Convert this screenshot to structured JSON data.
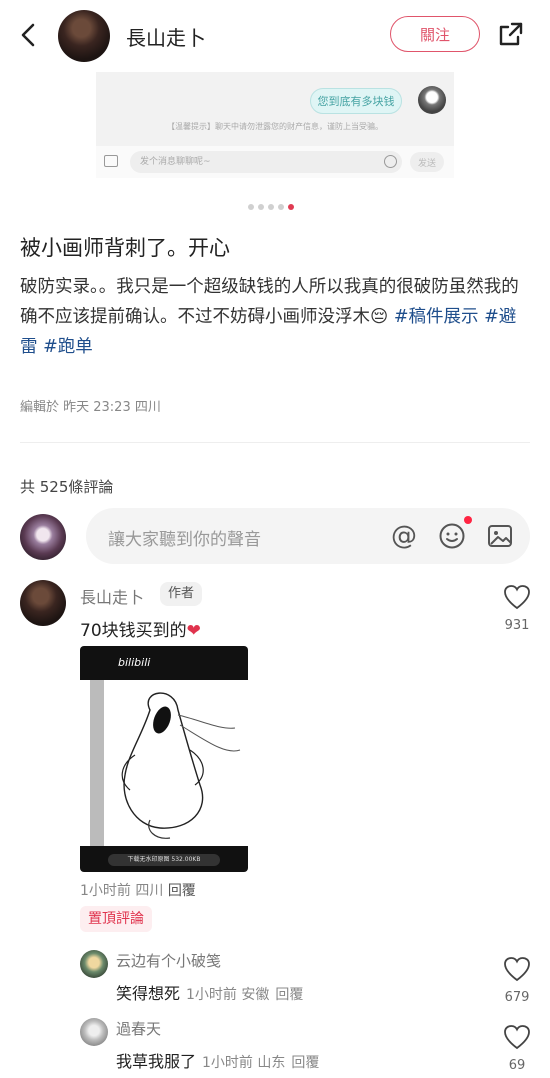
{
  "header": {
    "author_name": "長山走卜",
    "follow_label": "關注",
    "back_icon": "chevron-left-icon",
    "share_icon": "share-icon"
  },
  "embedded_screenshot": {
    "bubble_text": "您到底有多块钱",
    "system_tip": "【温馨提示】聊天中请勿泄露您的财产信息，谨防上当受骗。",
    "input_placeholder": "发个消息聊聊呢~",
    "send_label": "发送"
  },
  "carousel": {
    "count": 5,
    "active_index": 4,
    "accent": "#e03b52"
  },
  "post": {
    "title": "被小画师背刺了。开心",
    "body_text": "破防实录。。我只是一个超级缺钱的人所以我真的很破防虽然我的确不应该提前确认。不过不妨碍小画师没浮木😔",
    "tags": [
      "#稿件展示",
      "#避雷",
      "#跑单"
    ],
    "meta": "編輯於 昨天 23:23 四川"
  },
  "comments_section": {
    "count_label": "共 525條評論",
    "input_placeholder": "讓大家聽到你的聲音",
    "icons": [
      "at-icon",
      "emoji-icon",
      "image-icon"
    ]
  },
  "comment": {
    "name": "長山走卜",
    "author_badge": "作者",
    "text": "70块钱买到的",
    "image_logo": "bilibili",
    "image_bar": "下载无水印原图 532.00KB",
    "meta": "1小时前 四川",
    "reply_label": "回覆",
    "pinned_label": "置頂評論",
    "likes": "931"
  },
  "replies": [
    {
      "name": "云边有个小破笺",
      "text": "笑得想死",
      "meta": "1小时前 安徽",
      "reply_label": "回覆",
      "likes": "679"
    },
    {
      "name": "過春天",
      "text": "我草我服了",
      "meta": "1小时前 山东",
      "reply_label": "回覆",
      "likes": "69"
    }
  ],
  "colors": {
    "brand": "#e0556b",
    "tag": "#1f4e8c",
    "pin": "#e0334d"
  }
}
